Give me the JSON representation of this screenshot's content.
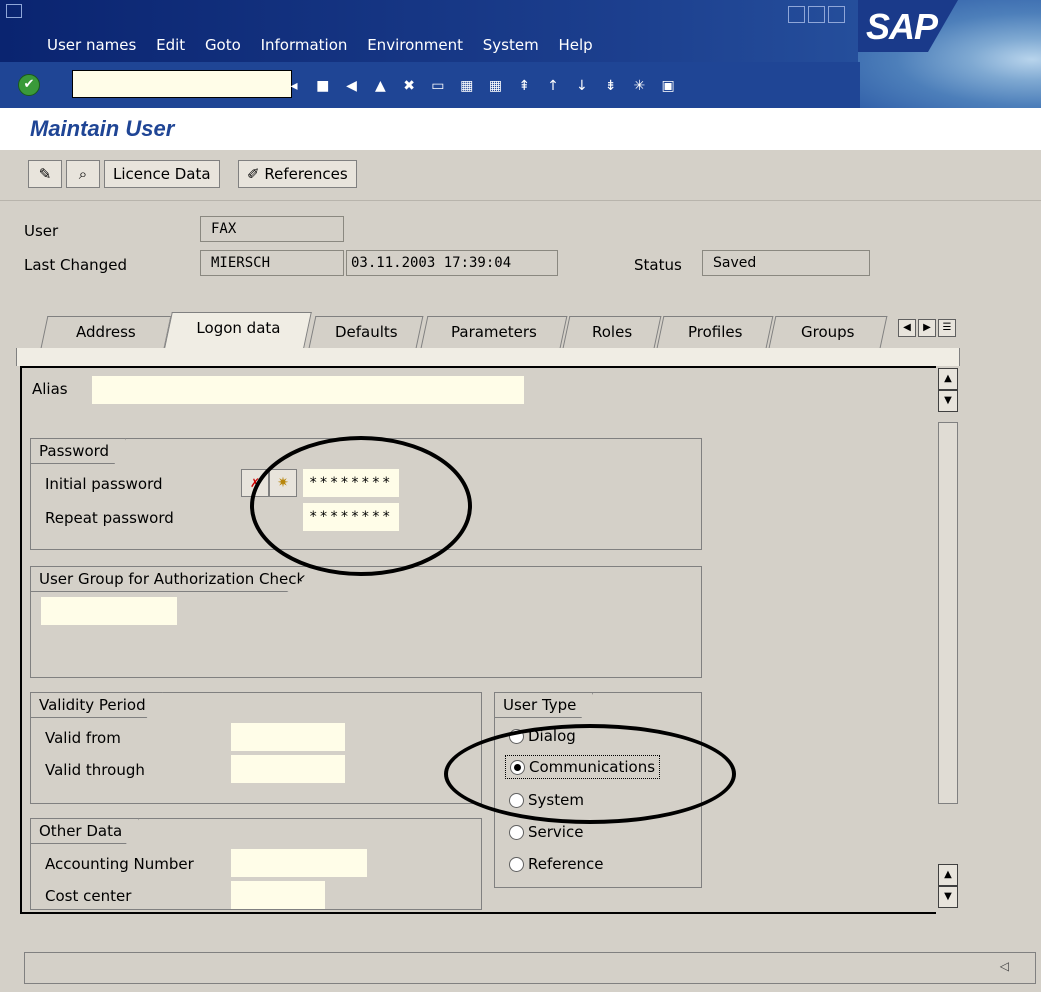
{
  "menubar": {
    "items": [
      "User names",
      "Edit",
      "Goto",
      "Information",
      "Environment",
      "System",
      "Help"
    ]
  },
  "logo": {
    "text": "SAP"
  },
  "page": {
    "title": "Maintain User"
  },
  "app_toolbar": {
    "licence_label": "Licence Data",
    "references_label": "References"
  },
  "header": {
    "user_label": "User",
    "user_value": "FAX",
    "last_changed_label": "Last Changed",
    "last_changed_by": "MIERSCH",
    "last_changed_at": "03.11.2003 17:39:04",
    "status_label": "Status",
    "status_value": "Saved"
  },
  "tabs": [
    "Address",
    "Logon data",
    "Defaults",
    "Parameters",
    "Roles",
    "Profiles",
    "Groups"
  ],
  "alias": {
    "label": "Alias",
    "value": ""
  },
  "password": {
    "group_title": "Password",
    "initial_label": "Initial password",
    "initial_value": "********",
    "repeat_label": "Repeat password",
    "repeat_value": "********"
  },
  "user_group": {
    "group_title": "User Group for Authorization Check",
    "value": ""
  },
  "validity": {
    "group_title": "Validity Period",
    "from_label": "Valid from",
    "from_value": "",
    "through_label": "Valid through",
    "through_value": ""
  },
  "other": {
    "group_title": "Other Data",
    "acct_label": "Accounting Number",
    "acct_value": "",
    "cost_label": "Cost center",
    "cost_value": ""
  },
  "user_type": {
    "group_title": "User Type",
    "options": [
      "Dialog",
      "Communications",
      "System",
      "Service",
      "Reference"
    ],
    "selected": "Communications"
  },
  "colors": {
    "menubar": "#0a2470",
    "toolbar": "#1f4595",
    "title": "#1f4595",
    "input_bg": "#fffde8",
    "panel": "#d4d0c8"
  }
}
